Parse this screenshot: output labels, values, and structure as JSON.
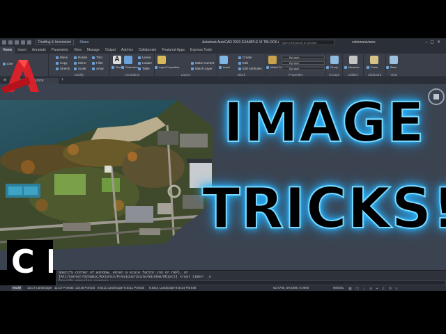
{
  "window": {
    "title": "Autodesk AutoCAD 2023   EXAMPLE VI TBLOCK.dwg",
    "workspace": "Drafting & Annotation",
    "share_label": "Share",
    "search_placeholder": "Type a keyword or phrase",
    "user": "colinmaniviews"
  },
  "ribbon": {
    "tabs": [
      "Home",
      "Insert",
      "Annotate",
      "Parametric",
      "View",
      "Manage",
      "Output",
      "Add-ins",
      "Collaborate",
      "Featured Apps",
      "Express Tools"
    ],
    "active_tab": "Home",
    "panels": {
      "draw": {
        "line": "Line"
      },
      "modify": {
        "title": "Modify",
        "commands": [
          "Move",
          "Rotate",
          "Trim",
          "Copy",
          "Mirror",
          "Fillet",
          "Stretch",
          "Scale",
          "Array"
        ]
      },
      "annotation": {
        "title": "Annotation",
        "commands": [
          "Text",
          "Dimension",
          "Linear",
          "Leader",
          "Table"
        ]
      },
      "layers": {
        "title": "Layers",
        "commands": [
          "Layer Properties",
          "Make Current",
          "Match Layer"
        ]
      },
      "block": {
        "title": "Block",
        "commands": [
          "Insert",
          "Create",
          "Edit",
          "Edit Attributes"
        ]
      },
      "properties": {
        "title": "Properties",
        "match_label": "Match Properties",
        "bylayer": [
          "ByLayer",
          "ByLayer",
          "ByLayer"
        ]
      },
      "groups": {
        "title": "Groups",
        "label": "Group"
      },
      "utilities": {
        "title": "Utilities",
        "label": "Measure"
      },
      "clipboard": {
        "title": "Clipboard",
        "label": "Paste"
      },
      "view": {
        "title": "View",
        "label": "Base"
      }
    }
  },
  "file_tabs": {
    "active": "EXAMPLE VI TBLOCK",
    "plus": "+"
  },
  "overlay": {
    "line1": "IMAGE",
    "line2": "TRICKS!"
  },
  "command_line": {
    "lines": [
      "Specify corner of window, enter a scale factor (nX or nXP), or",
      "[All/Center/Dynamic/Extents/Previous/Scale/Window/Object] <real time>: _o",
      "Specify opposite corner:"
    ]
  },
  "layout_tabs": [
    "Model",
    "11x17 Landscape",
    "11x17 Portrait",
    "12x18 Portrait",
    "8.5x11 Landscape",
    "8.5x11 Portrait",
    "8.5x14 Landscape",
    "8.5x14 Portrait"
  ],
  "status": {
    "coordinates": "62.5786, 59.6356, 0.0000",
    "space": "MODEL"
  },
  "logos": {
    "app_letter": "A",
    "channel": "C I"
  },
  "colors": {
    "accent_glow": "#29b8ff",
    "ribbon_bg": "#3a3f4a",
    "autocad_red": "#d8222b"
  }
}
